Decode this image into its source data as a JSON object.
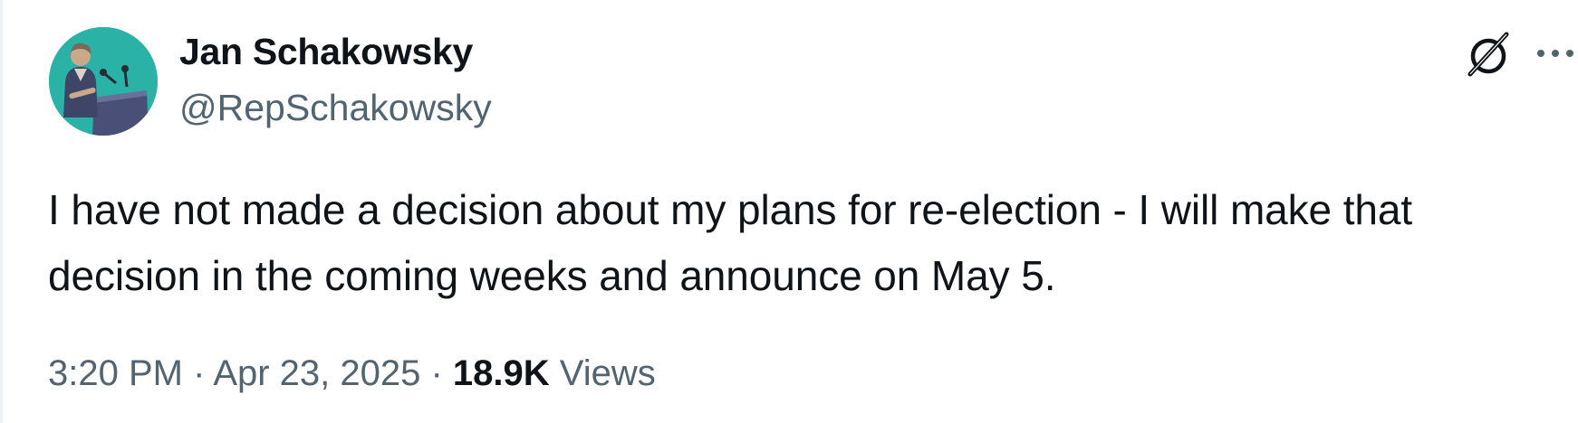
{
  "author": {
    "name": "Jan Schakowsky",
    "handle": "@RepSchakowsky"
  },
  "icons": {
    "avatar": "profile-photo-podium",
    "grok": "grok-icon",
    "more": "more-horizontal-icon"
  },
  "tweet": {
    "text": "I have not made a decision about my plans for re-election - I will make that decision in the coming weeks and announce on May 5."
  },
  "meta": {
    "time": "3:20 PM",
    "separator1": " · ",
    "date": "Apr 23, 2025",
    "separator2": " · ",
    "views_count": "18.9K",
    "views_label": " Views"
  },
  "colors": {
    "text_primary": "#0f1419",
    "text_secondary": "#536471",
    "avatar_bg": "#2bb2a6"
  }
}
